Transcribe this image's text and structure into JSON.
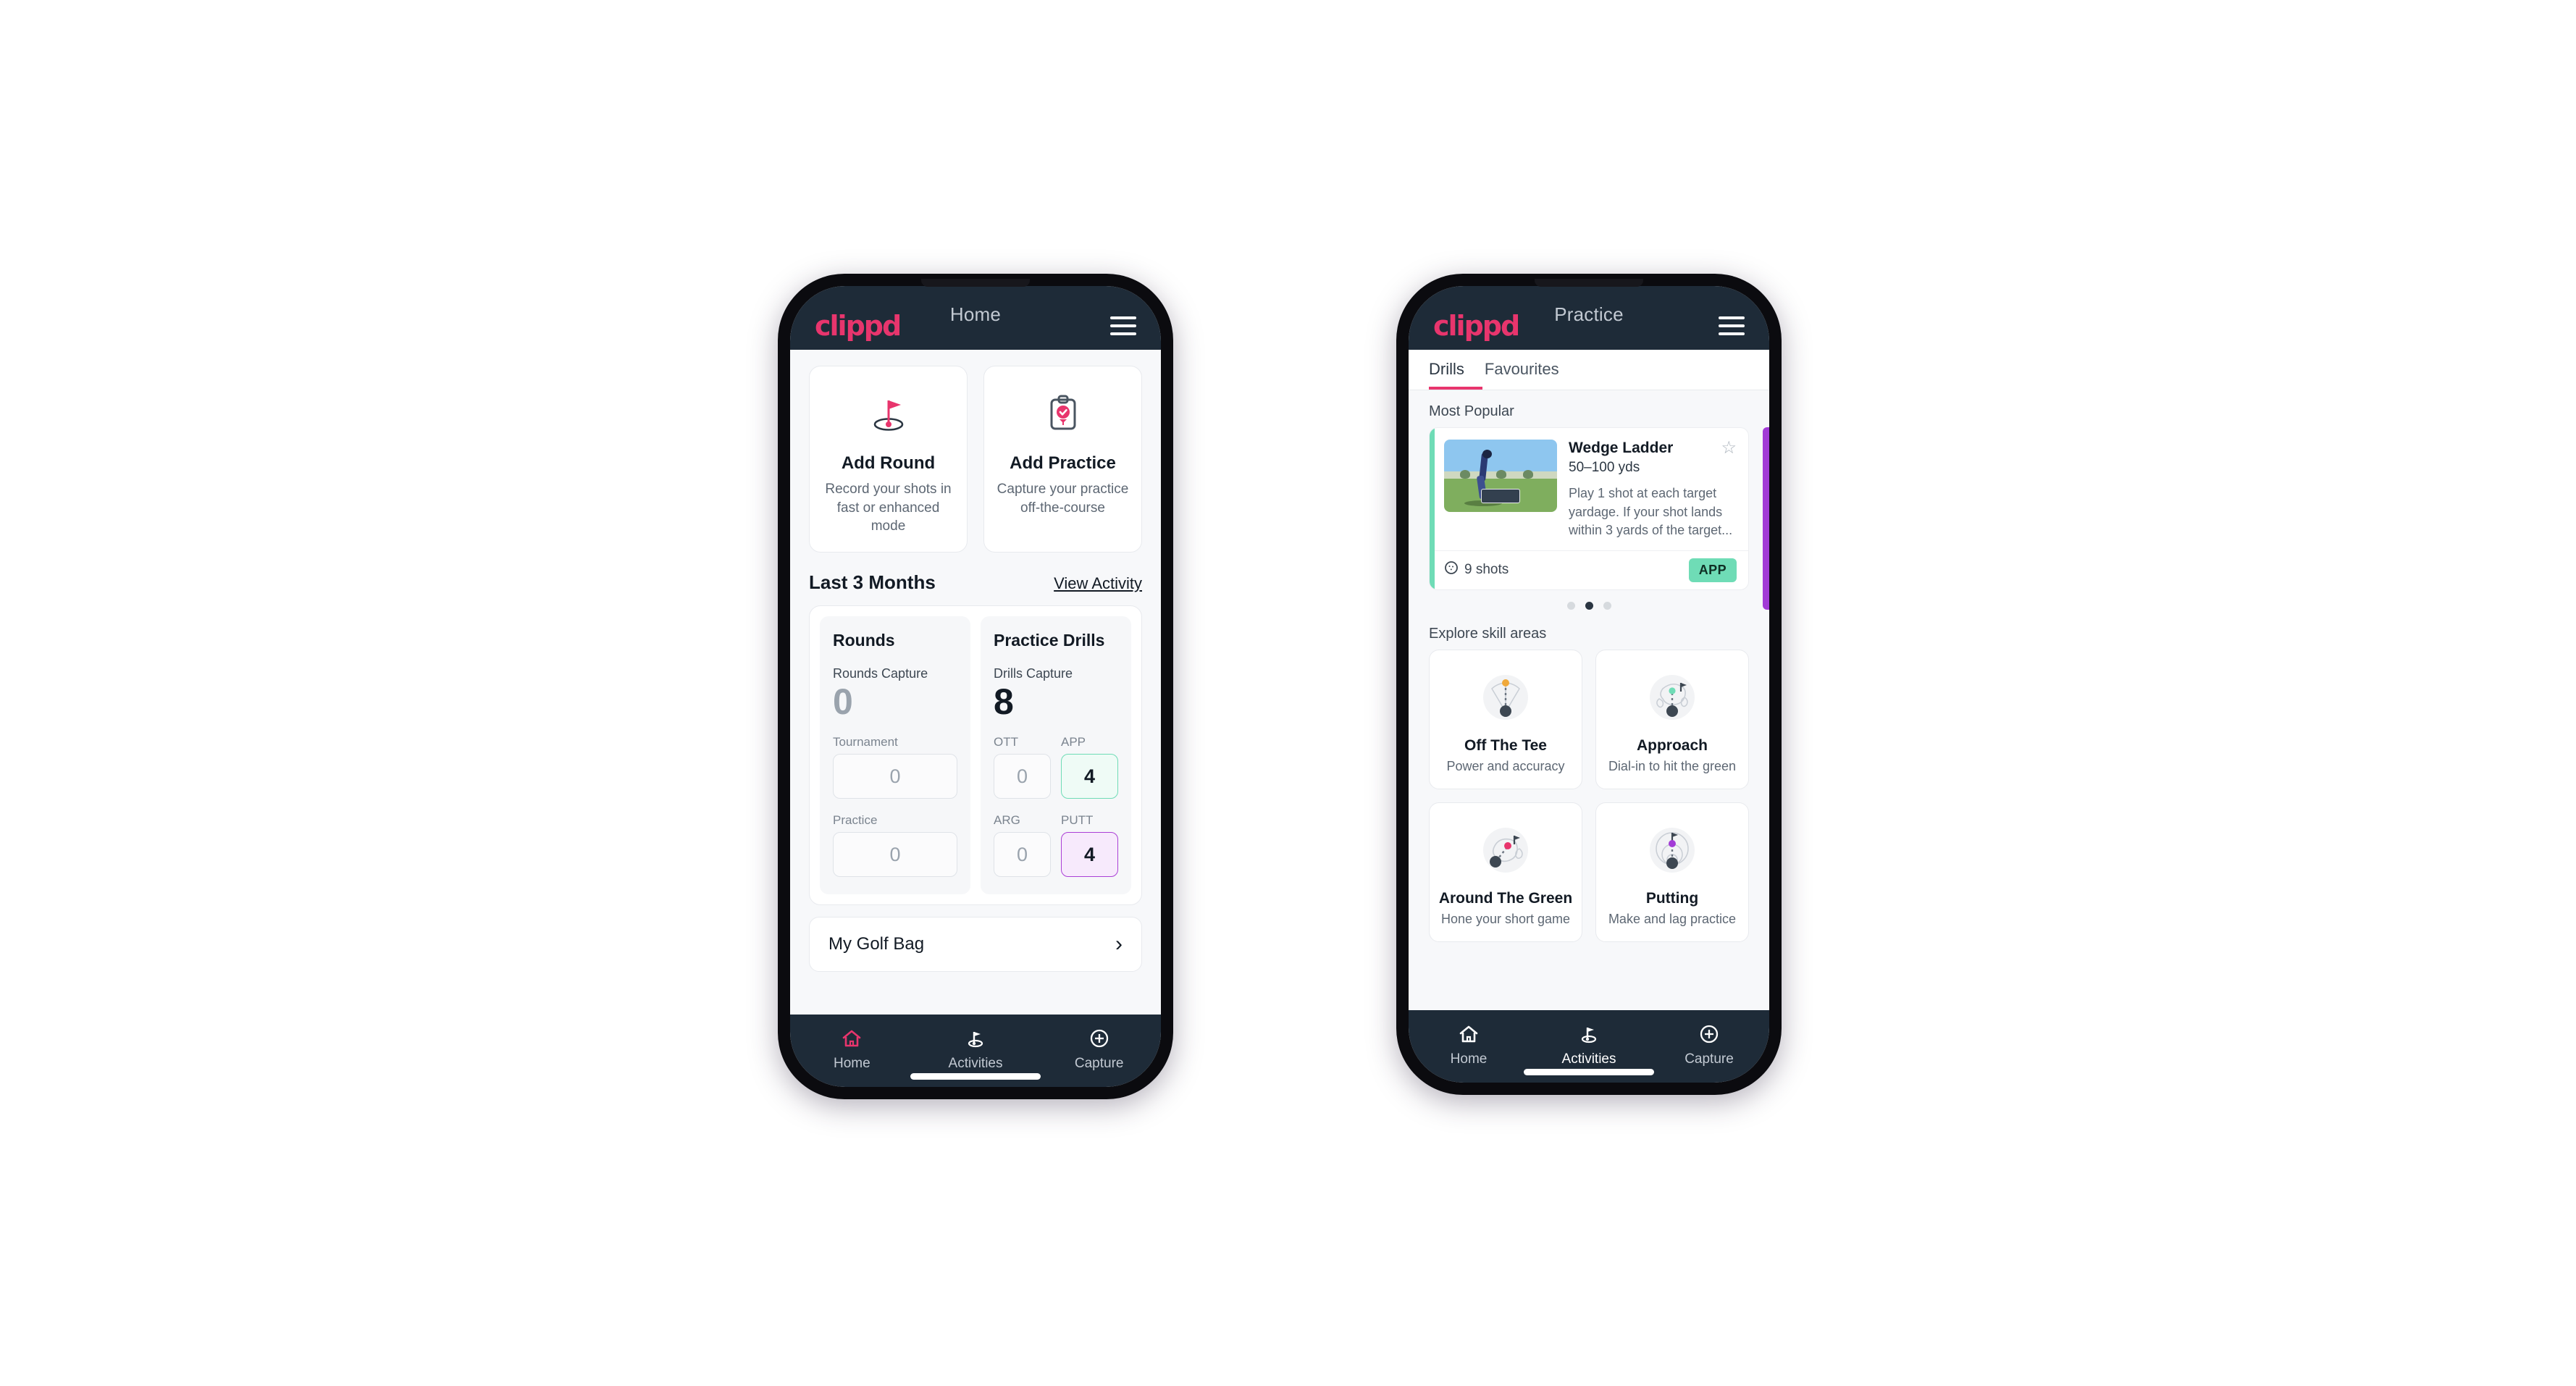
{
  "brand": {
    "logo": "clippd",
    "accent": "#e8356d",
    "appbar_bg": "#1e2b38"
  },
  "home": {
    "title": "Home",
    "actions": [
      {
        "icon": "golf-flag-icon",
        "title": "Add Round",
        "sub_line1": "Record your shots in",
        "sub_line2": "fast or enhanced mode"
      },
      {
        "icon": "clipboard-check-icon",
        "title": "Add Practice",
        "sub_line1": "Capture your practice",
        "sub_line2": "off-the-course"
      }
    ],
    "section": {
      "title": "Last 3 Months",
      "link": "View Activity"
    },
    "rounds": {
      "heading": "Rounds",
      "capture_label": "Rounds Capture",
      "capture_value": "0",
      "fields": [
        {
          "label": "Tournament",
          "value": "0"
        },
        {
          "label": "Practice",
          "value": "0"
        }
      ]
    },
    "drills": {
      "heading": "Practice Drills",
      "capture_label": "Drills Capture",
      "capture_value": "8",
      "fields": [
        {
          "label": "OTT",
          "value": "0",
          "state": "plain"
        },
        {
          "label": "APP",
          "value": "4",
          "state": "app"
        },
        {
          "label": "ARG",
          "value": "0",
          "state": "plain"
        },
        {
          "label": "PUTT",
          "value": "4",
          "state": "putt"
        }
      ]
    },
    "golf_bag": {
      "label": "My Golf Bag",
      "chevron": "›"
    },
    "nav": [
      {
        "name": "home",
        "label": "Home",
        "icon": "house-icon",
        "active": true
      },
      {
        "name": "activities",
        "label": "Activities",
        "icon": "golf-flag-icon",
        "active": false
      },
      {
        "name": "capture",
        "label": "Capture",
        "icon": "plus-circle-icon",
        "active": false
      }
    ]
  },
  "practice": {
    "title": "Practice",
    "tabs": [
      {
        "label": "Drills",
        "active": true
      },
      {
        "label": "Favourites",
        "active": false
      }
    ],
    "most_popular_label": "Most Popular",
    "drill": {
      "title": "Wedge Ladder",
      "yardage": "50–100 yds",
      "description": "Play 1 shot at each target yardage. If your shot lands within 3 yards of the target...",
      "shots": "9 shots",
      "chip": "APP",
      "accent": "#6fdcb6",
      "star": "☆"
    },
    "carousel_dots": [
      false,
      true,
      false
    ],
    "skill_header": "Explore skill areas",
    "skills": [
      {
        "icon": "tee-fan-icon",
        "title": "Off The Tee",
        "sub": "Power and accuracy",
        "dot": "#f0a93b"
      },
      {
        "icon": "green-target-icon",
        "title": "Approach",
        "sub": "Dial-in to hit the green",
        "dot": "#6fdcb6"
      },
      {
        "icon": "chip-green-icon",
        "title": "Around The Green",
        "sub": "Hone your short game",
        "dot": "#e8356d"
      },
      {
        "icon": "putt-rings-icon",
        "title": "Putting",
        "sub": "Make and lag practice",
        "dot": "#a23bd6"
      }
    ],
    "nav": [
      {
        "name": "home",
        "label": "Home",
        "icon": "house-icon",
        "active": false
      },
      {
        "name": "activities",
        "label": "Activities",
        "icon": "golf-flag-icon",
        "active": true
      },
      {
        "name": "capture",
        "label": "Capture",
        "icon": "plus-circle-icon",
        "active": false
      }
    ]
  }
}
